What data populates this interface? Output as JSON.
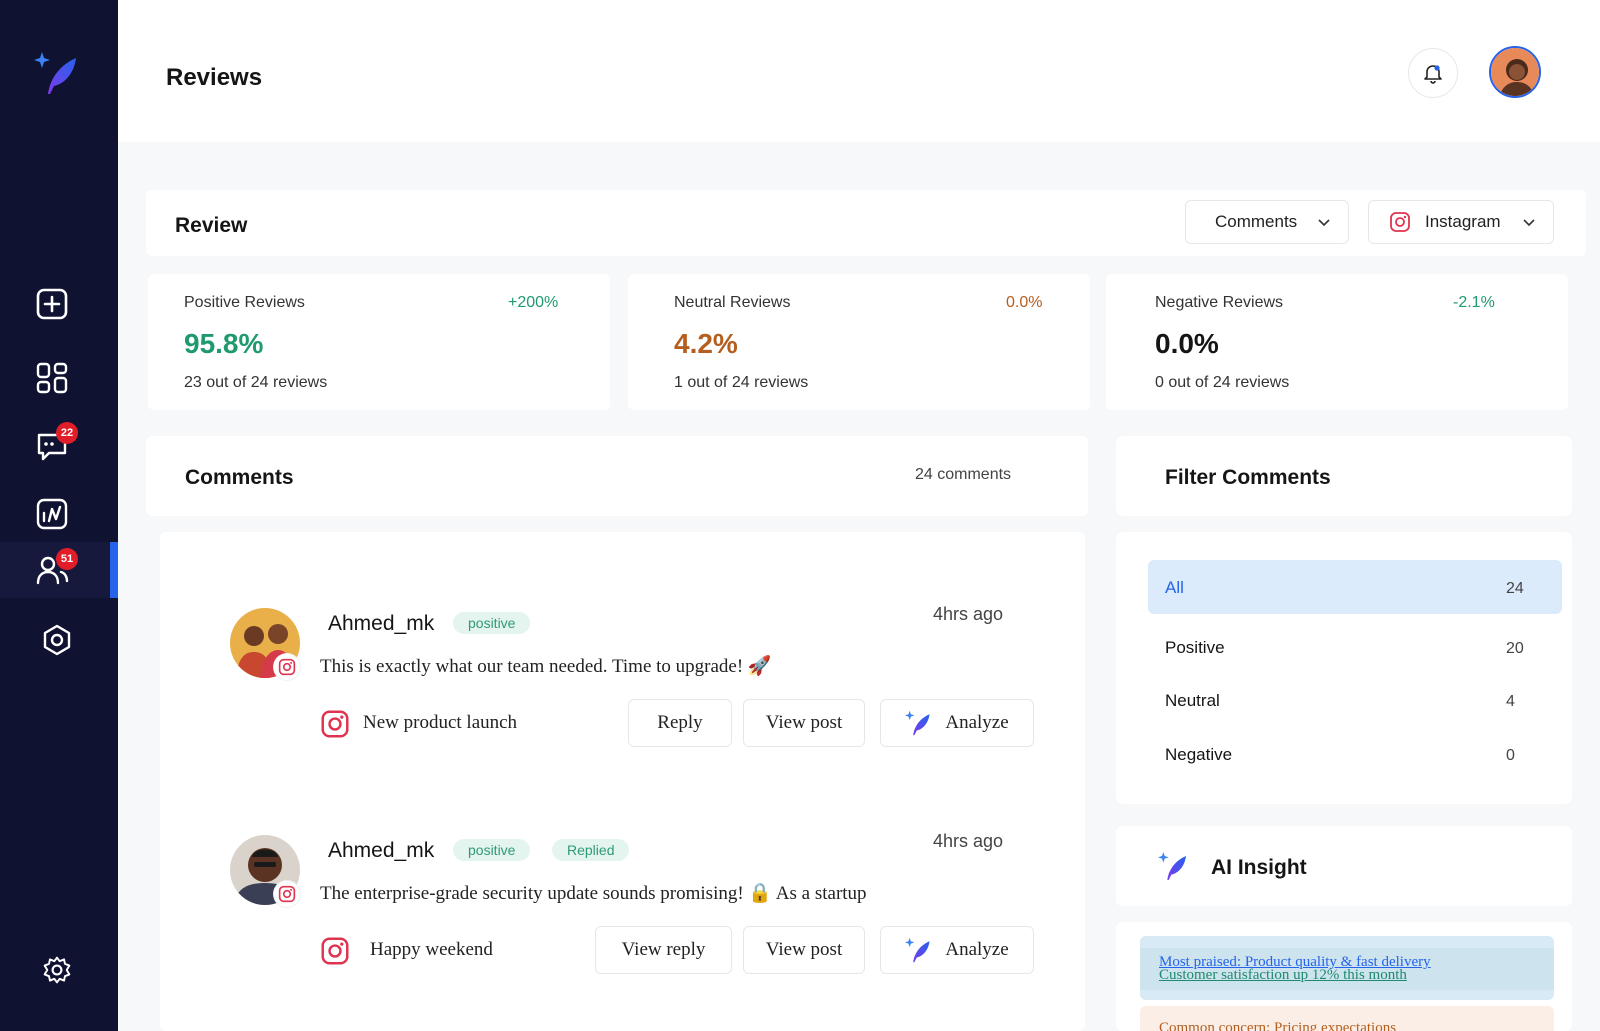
{
  "header": {
    "title": "Reviews"
  },
  "sidebar": {
    "badges": {
      "messages": "22",
      "users": "51"
    }
  },
  "review": {
    "title": "Review",
    "type_dropdown": "Comments",
    "platform_dropdown": "Instagram"
  },
  "stats": [
    {
      "label": "Positive Reviews",
      "change": "+200%",
      "value": "95.8%",
      "sub": "23 out of 24 reviews",
      "color": "#1f9a6e",
      "change_color": "#1f9a6e"
    },
    {
      "label": "Neutral Reviews",
      "change": "0.0%",
      "value": "4.2%",
      "sub": "1 out of 24 reviews",
      "color": "#b45f1f",
      "change_color": "#b45f1f"
    },
    {
      "label": "Negative Reviews",
      "change": "-2.1%",
      "value": "0.0%",
      "sub": "0 out of 24 reviews",
      "color": "#151515",
      "change_color": "#1f9a6e"
    }
  ],
  "comments": {
    "title": "Comments",
    "count": "24 comments",
    "items": [
      {
        "user": "Ahmed_mk",
        "tags": [
          "positive"
        ],
        "time": "4hrs ago",
        "text": "This is exactly what our team needed. Time to upgrade! 🚀",
        "post": "New product launch",
        "buttons": [
          "Reply",
          "View post",
          "Analyze"
        ]
      },
      {
        "user": "Ahmed_mk",
        "tags": [
          "positive",
          "Replied"
        ],
        "time": "4hrs ago",
        "text": "The enterprise-grade security update sounds promising! 🔒 As a startup",
        "post": "Happy weekend",
        "buttons": [
          "View reply",
          "View post",
          "Analyze"
        ]
      }
    ]
  },
  "filter": {
    "title": "Filter Comments",
    "options": [
      {
        "label": "All",
        "count": "24"
      },
      {
        "label": "Positive",
        "count": "20"
      },
      {
        "label": "Neutral",
        "count": "4"
      },
      {
        "label": "Negative",
        "count": "0"
      }
    ]
  },
  "ai_insight": {
    "title": "AI Insight",
    "insights": [
      "Most praised: Product quality & fast delivery",
      "Customer satisfaction up 12% this month",
      "Common concern: Pricing expectations"
    ]
  },
  "colors": {
    "sidebar": "#0f1230",
    "accent": "#2563eb",
    "badge": "#e11d2a",
    "instagram": "#e0334f"
  }
}
